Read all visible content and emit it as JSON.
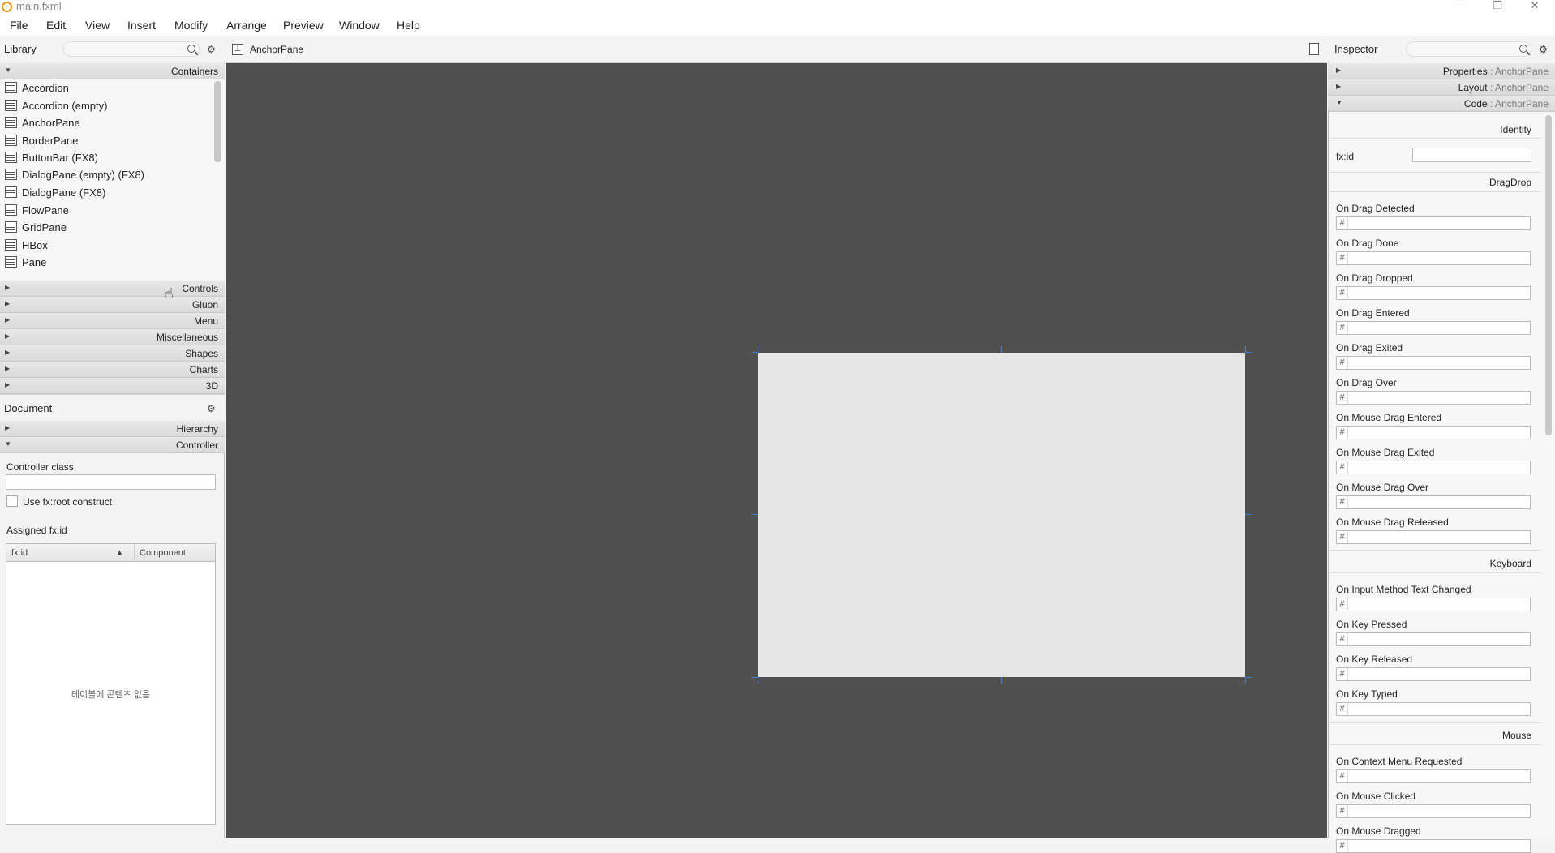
{
  "window": {
    "title": "main.fxml",
    "controls": [
      "–",
      "❐",
      "✕"
    ]
  },
  "menubar": [
    "File",
    "Edit",
    "View",
    "Insert",
    "Modify",
    "Arrange",
    "Preview",
    "Window",
    "Help"
  ],
  "library": {
    "title": "Library",
    "sections": {
      "containers": "Containers",
      "controls": "Controls",
      "gluon": "Gluon",
      "menu": "Menu",
      "misc": "Miscellaneous",
      "shapes": "Shapes",
      "charts": "Charts",
      "threed": "3D"
    },
    "items": [
      "Accordion",
      "Accordion  (empty)",
      "AnchorPane",
      "BorderPane",
      "ButtonBar  (FX8)",
      "DialogPane (empty)  (FX8)",
      "DialogPane  (FX8)",
      "FlowPane",
      "GridPane",
      "HBox",
      "Pane"
    ]
  },
  "document": {
    "title": "Document",
    "sections": {
      "hierarchy": "Hierarchy",
      "controller": "Controller"
    },
    "controller_class_label": "Controller class",
    "use_root_label": "Use fx:root construct",
    "assigned_label": "Assigned fx:id",
    "table_headers": {
      "fxid": "fx:id",
      "component": "Component"
    },
    "empty_message": "테이블에 콘텐츠 없음"
  },
  "center": {
    "breadcrumb": "AnchorPane"
  },
  "inspector": {
    "title": "Inspector",
    "sections": [
      {
        "name": "Properties",
        "sub": " : AnchorPane"
      },
      {
        "name": "Layout",
        "sub": " : AnchorPane"
      },
      {
        "name": "Code",
        "sub": " : AnchorPane"
      }
    ],
    "groups": {
      "identity": "Identity",
      "dragdrop": "DragDrop",
      "keyboard": "Keyboard",
      "mouse": "Mouse"
    },
    "fxid_label": "fx:id",
    "hash": "#",
    "dragdrop_events": [
      "On Drag Detected",
      "On Drag Done",
      "On Drag Dropped",
      "On Drag Entered",
      "On Drag Exited",
      "On Drag Over",
      "On Mouse Drag Entered",
      "On Mouse Drag Exited",
      "On Mouse Drag Over",
      "On Mouse Drag Released"
    ],
    "keyboard_events": [
      "On Input Method Text Changed",
      "On Key Pressed",
      "On Key Released",
      "On Key Typed"
    ],
    "mouse_events": [
      "On Context Menu Requested",
      "On Mouse Clicked",
      "On Mouse Dragged"
    ]
  }
}
